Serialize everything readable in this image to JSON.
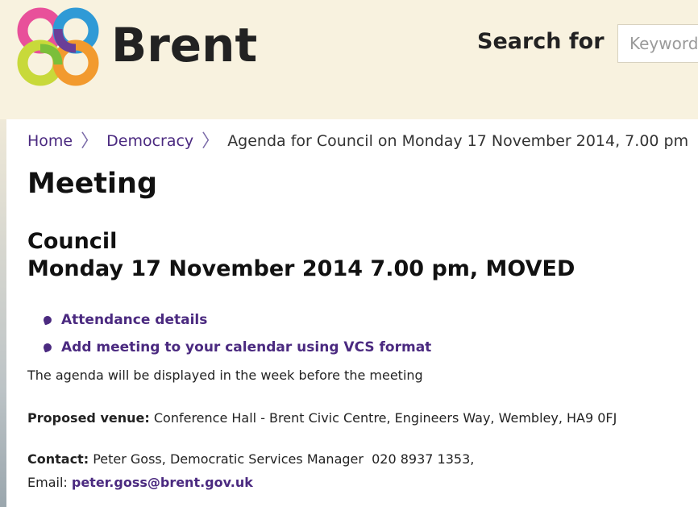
{
  "header": {
    "brand": "Brent",
    "search_label": "Search for",
    "search_placeholder": "Keywords",
    "logo_colors": [
      "#e8509a",
      "#2f9ad6",
      "#7bbf3a",
      "#f29a2e",
      "#6a3f98",
      "#c8d93a"
    ]
  },
  "breadcrumb": {
    "home": "Home",
    "democracy": "Democracy",
    "current": "Agenda for Council on Monday 17 November 2014, 7.00 pm",
    "separator": "〉"
  },
  "page_title": "Meeting",
  "meeting": {
    "committee": "Council",
    "datetime": "Monday 17 November 2014 7.00 pm, MOVED"
  },
  "links": [
    {
      "label": "Attendance details"
    },
    {
      "label": "Add meeting to your calendar using VCS format"
    }
  ],
  "agenda_note": "The agenda will be displayed in the week before the meeting",
  "venue": {
    "label": "Proposed venue:",
    "value": "Conference Hall - Brent Civic Centre, Engineers Way, Wembley, HA9 0FJ"
  },
  "contact": {
    "label": "Contact:",
    "value": "Peter Goss, Democratic Services Manager  020 8937 1353,",
    "email_label": "Email:",
    "email": "peter.goss@brent.gov.uk"
  },
  "colors": {
    "link": "#4b2a80",
    "header_bg": "#f8f2df"
  }
}
